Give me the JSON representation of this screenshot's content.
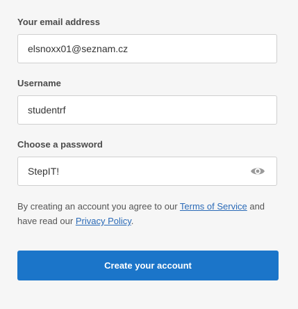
{
  "email": {
    "label": "Your email address",
    "value": "elsnoxx01@seznam.cz"
  },
  "username": {
    "label": "Username",
    "value": "studentrf"
  },
  "password": {
    "label": "Choose a password",
    "value": "StepIT!",
    "toggle_icon": "eye-icon"
  },
  "terms": {
    "prefix": "By creating an account you agree to our ",
    "terms_link": "Terms of Service",
    "middle": " and have read our ",
    "privacy_link": "Privacy Policy",
    "suffix": "."
  },
  "submit": {
    "label": "Create your account"
  },
  "colors": {
    "accent": "#1b75c9",
    "link": "#2a6ab7",
    "background": "#f6f6f6"
  }
}
